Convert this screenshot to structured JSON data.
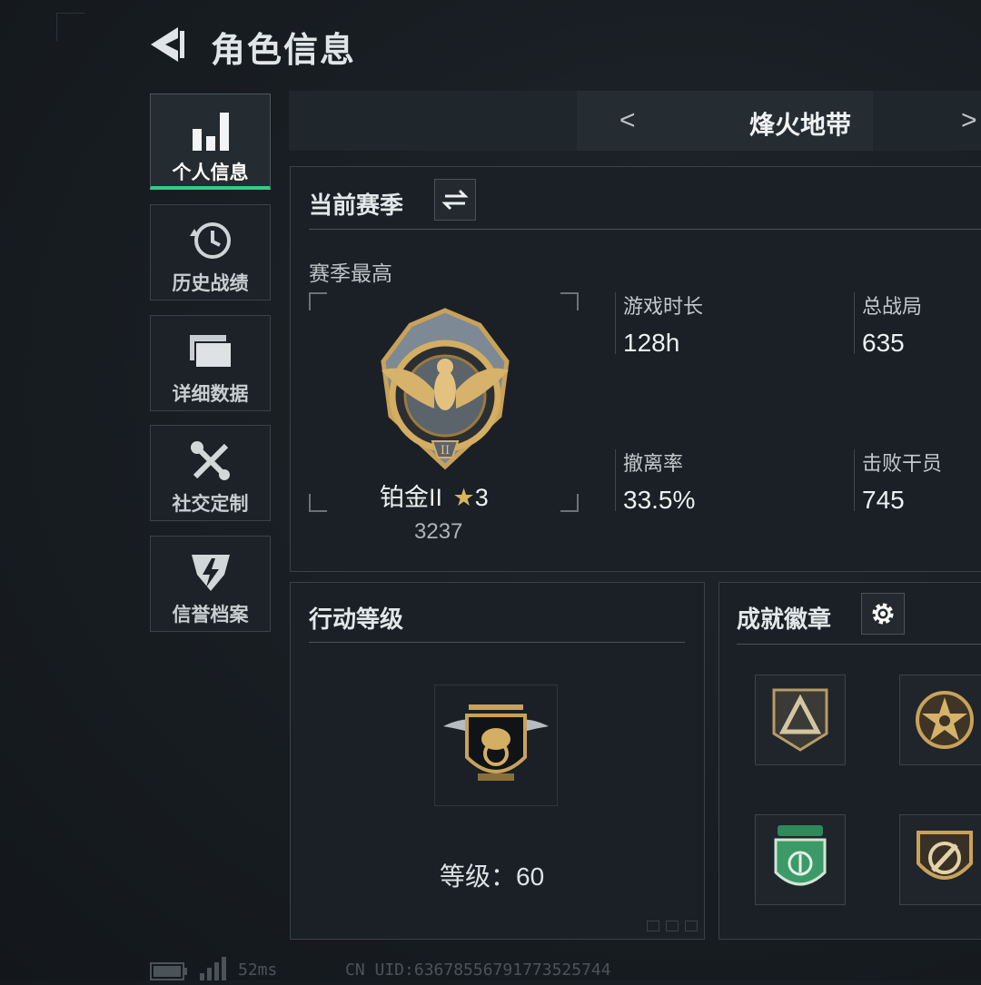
{
  "header": {
    "title": "角色信息"
  },
  "sidebar": {
    "items": [
      {
        "label": "个人信息",
        "icon": "bar-chart-icon",
        "active": true
      },
      {
        "label": "历史战绩",
        "icon": "history-clock-icon",
        "active": false
      },
      {
        "label": "详细数据",
        "icon": "folders-icon",
        "active": false
      },
      {
        "label": "社交定制",
        "icon": "wrench-screwdriver-icon",
        "active": false
      },
      {
        "label": "信誉档案",
        "icon": "shield-lightning-icon",
        "active": false
      }
    ]
  },
  "mode": {
    "prev": "<",
    "name": "烽火地带",
    "next": ">"
  },
  "season": {
    "title": "当前赛季",
    "best_label": "赛季最高",
    "rank_name": "铂金II",
    "rank_star": "★",
    "rank_stars": "3",
    "rank_score": "3237",
    "stats": [
      {
        "label": "游戏时长",
        "value": "128h"
      },
      {
        "label": "总战局",
        "value": "635"
      },
      {
        "label": "撤离率",
        "value": "33.5%"
      },
      {
        "label": "击败干员",
        "value": "745"
      }
    ]
  },
  "level": {
    "title": "行动等级",
    "label": "等级：",
    "value": "60"
  },
  "badges": {
    "title": "成就徽章"
  },
  "footer": {
    "ping": "52ms",
    "uid": "CN UID:63678556791773525744"
  },
  "colors": {
    "accent": "#2ccf8a",
    "gold": "#c9a25a"
  }
}
